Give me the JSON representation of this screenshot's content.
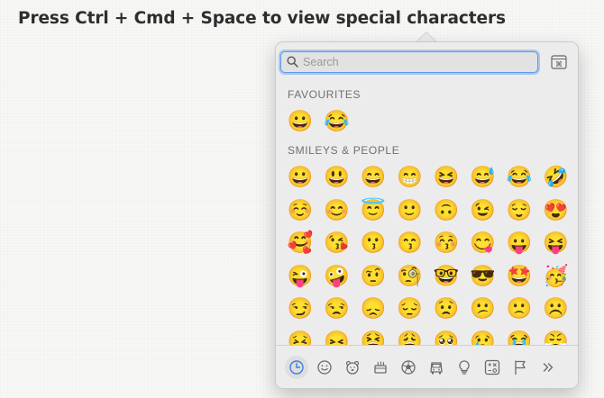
{
  "headline": "Press Ctrl + Cmd + Space to view special characters",
  "search": {
    "placeholder": "Search"
  },
  "favourites": {
    "label": "FAVOURITES",
    "items": [
      "😀",
      "😂"
    ]
  },
  "smileys": {
    "label": "SMILEYS & PEOPLE",
    "items": [
      "😀",
      "😃",
      "😄",
      "😁",
      "😆",
      "😅",
      "😂",
      "🤣",
      "☺️",
      "😊",
      "😇",
      "🙂",
      "🙃",
      "😉",
      "😌",
      "😍",
      "🥰",
      "😘",
      "😗",
      "😙",
      "😚",
      "😋",
      "😛",
      "😝",
      "😜",
      "🤪",
      "🤨",
      "🧐",
      "🤓",
      "😎",
      "🤩",
      "🥳",
      "😏",
      "😒",
      "😞",
      "😔",
      "😟",
      "😕",
      "🙁",
      "☹️",
      "😣",
      "😖",
      "😫",
      "😩",
      "🥺",
      "😢",
      "😭",
      "😤"
    ]
  },
  "categories": [
    {
      "name": "recent",
      "active": true
    },
    {
      "name": "smileys"
    },
    {
      "name": "animals"
    },
    {
      "name": "food"
    },
    {
      "name": "activity"
    },
    {
      "name": "travel"
    },
    {
      "name": "objects"
    },
    {
      "name": "symbols"
    },
    {
      "name": "flags"
    },
    {
      "name": "more"
    }
  ],
  "colors": {
    "accent": "#5b9bf0",
    "icon": "#6b6b6b"
  }
}
